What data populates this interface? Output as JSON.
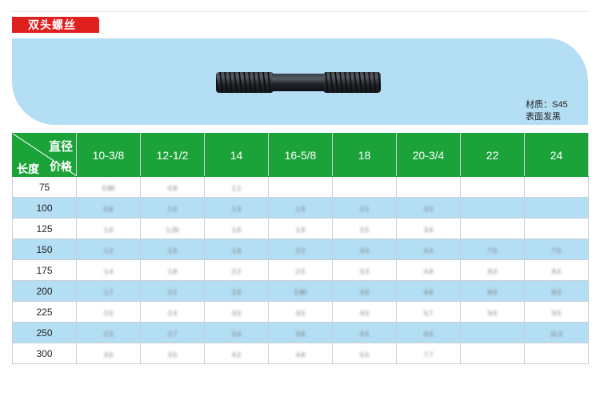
{
  "title": "双头螺丝",
  "material": {
    "line1": "材质：S45",
    "line2": "表面发黑"
  },
  "table": {
    "corner": {
      "diameter": "直径",
      "price": "价格",
      "length": "长度"
    },
    "sizes": [
      "10-3/8",
      "12-1/2",
      "14",
      "16-5/8",
      "18",
      "20-3/4",
      "22",
      "24"
    ],
    "lengths": [
      "75",
      "100",
      "125",
      "150",
      "175",
      "200",
      "225",
      "250",
      "300"
    ],
    "prices": [
      [
        "0.80",
        "0.8",
        "1.1",
        "",
        "",
        "",
        "",
        ""
      ],
      [
        "0.9",
        "1.0",
        "1.3",
        "1.9",
        "2.1",
        "3.0",
        "",
        ""
      ],
      [
        "1.0",
        "1.20",
        "1.6",
        "1.9",
        "2.5",
        "3.4",
        "",
        ""
      ],
      [
        "1.2",
        "1.5",
        "1.8",
        "2.2",
        "3.0",
        "4.4",
        "7.5",
        "7.5"
      ],
      [
        "1.4",
        "1.8",
        "2.2",
        "2.5",
        "3.3",
        "4.8",
        "8.0",
        "8.5"
      ],
      [
        "1.7",
        "2.1",
        "2.5",
        "2.80",
        "3.5",
        "4.8",
        "8.0",
        "8.5"
      ],
      [
        "2.0",
        "2.4",
        "3.0",
        "3.5",
        "4.0",
        "5.7",
        "9.0",
        "9.5"
      ],
      [
        "2.3",
        "2.7",
        "3.4",
        "3.8",
        "4.5",
        "6.0",
        "",
        "11.0"
      ],
      [
        "3.0",
        "3.5",
        "4.2",
        "4.8",
        "5.5",
        "7.7",
        "",
        ""
      ]
    ]
  }
}
